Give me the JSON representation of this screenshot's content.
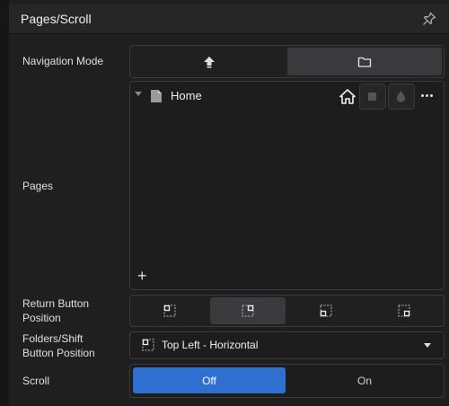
{
  "panel": {
    "title": "Pages/Scroll",
    "pin_icon": "pin-icon"
  },
  "navigation_mode": {
    "label": "Navigation Mode",
    "options": [
      {
        "icon": "upload-arrow-icon",
        "selected": false
      },
      {
        "icon": "folder-icon",
        "selected": true
      }
    ]
  },
  "pages": {
    "label": "Pages",
    "items": [
      {
        "name": "Home",
        "is_home": true
      }
    ],
    "add_label": "+"
  },
  "return_button_position": {
    "label_line1": "Return Button",
    "label_line2": "Position",
    "options": [
      {
        "icon": "position-top-left-icon",
        "selected": false
      },
      {
        "icon": "position-top-right-icon",
        "selected": true
      },
      {
        "icon": "position-bottom-left-icon",
        "selected": false
      },
      {
        "icon": "position-bottom-right-icon",
        "selected": false
      }
    ]
  },
  "folders_shift_position": {
    "label_line1": "Folders/Shift",
    "label_line2": "Button Position",
    "value": "Top Left - Horizontal"
  },
  "scroll": {
    "label": "Scroll",
    "off_label": "Off",
    "on_label": "On",
    "selected": "Off"
  },
  "colors": {
    "accent": "#2e6fd0",
    "panel_bg": "#1f1f1f"
  }
}
